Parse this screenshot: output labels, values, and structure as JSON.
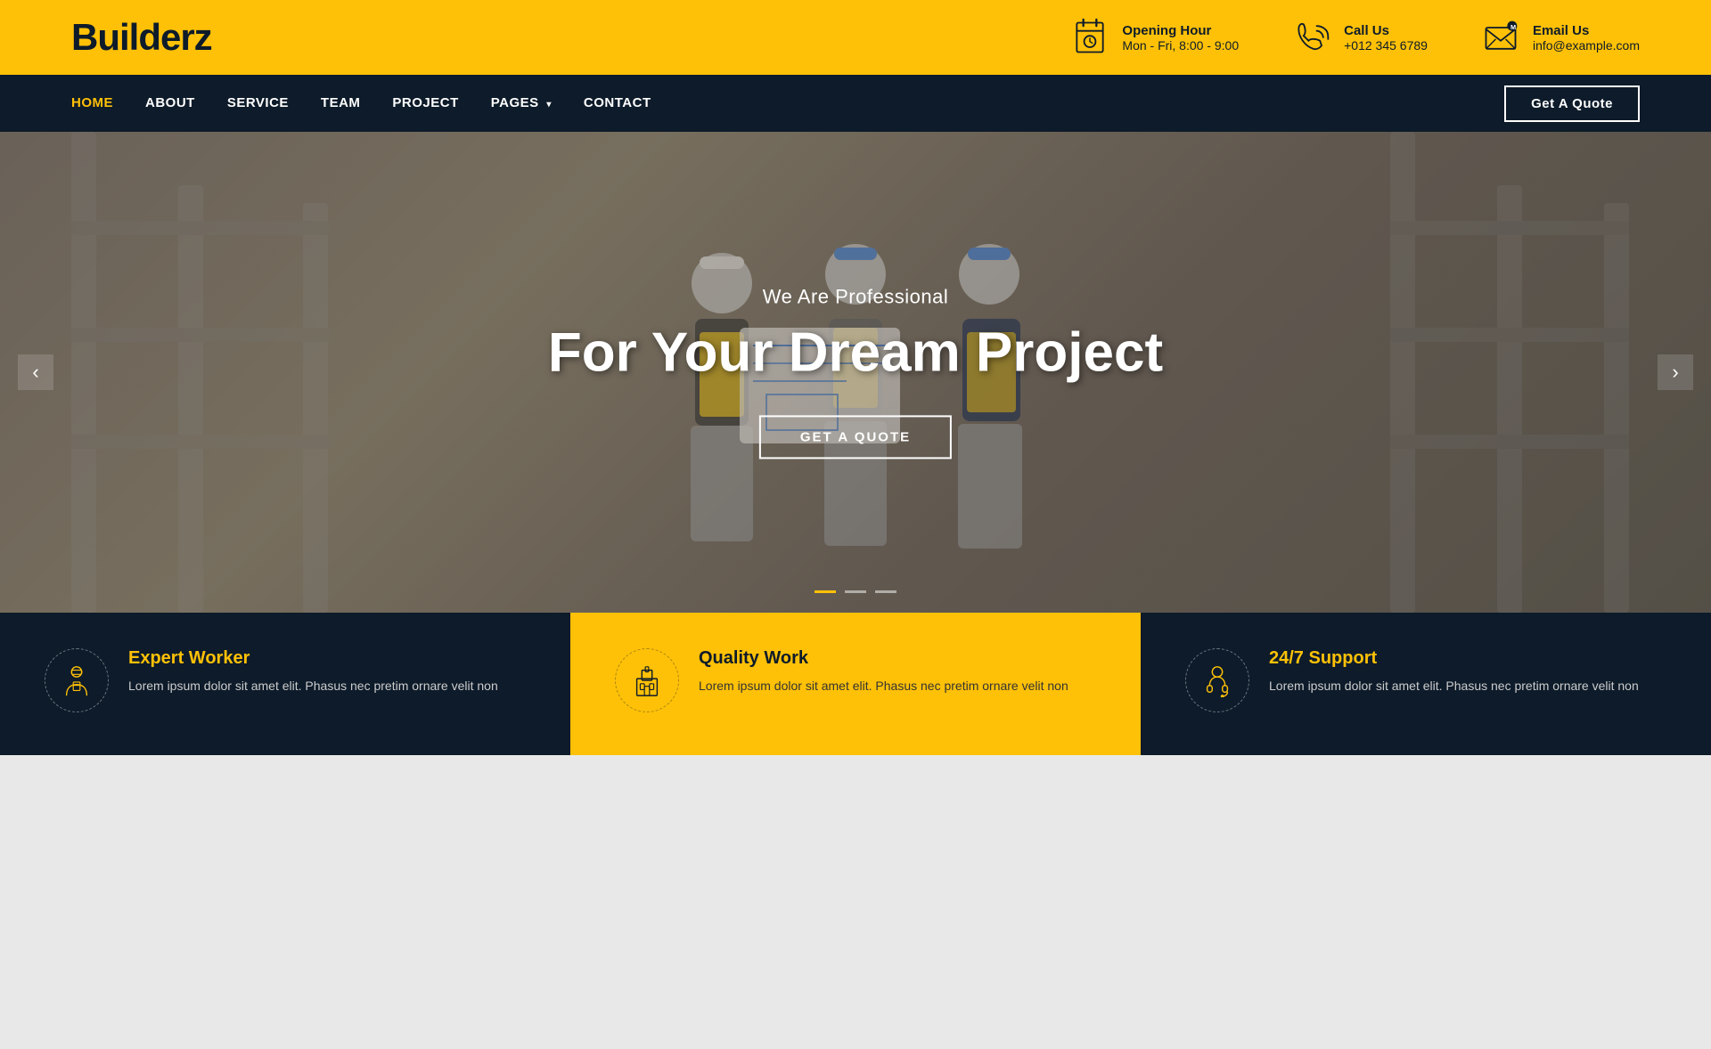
{
  "brand": {
    "logo": "Builderz"
  },
  "topbar": {
    "opening_hour": {
      "label": "Opening Hour",
      "value": "Mon - Fri, 8:00 - 9:00"
    },
    "call_us": {
      "label": "Call Us",
      "value": "+012 345 6789"
    },
    "email_us": {
      "label": "Email Us",
      "value": "info@example.com"
    }
  },
  "navbar": {
    "links": [
      {
        "id": "home",
        "label": "HOME",
        "active": true,
        "has_dropdown": false
      },
      {
        "id": "about",
        "label": "ABOUT",
        "active": false,
        "has_dropdown": false
      },
      {
        "id": "service",
        "label": "SERVICE",
        "active": false,
        "has_dropdown": false
      },
      {
        "id": "team",
        "label": "TEAM",
        "active": false,
        "has_dropdown": false
      },
      {
        "id": "project",
        "label": "PROJECT",
        "active": false,
        "has_dropdown": false
      },
      {
        "id": "pages",
        "label": "PAGES",
        "active": false,
        "has_dropdown": true
      },
      {
        "id": "contact",
        "label": "CONTACT",
        "active": false,
        "has_dropdown": false
      }
    ],
    "cta_label": "Get A Quote"
  },
  "hero": {
    "subtitle": "We Are Professional",
    "title": "For Your Dream Project",
    "cta_label": "GET A QUOTE",
    "prev_arrow": "‹",
    "next_arrow": "›",
    "dots": [
      "active",
      "",
      ""
    ]
  },
  "features": [
    {
      "id": "expert-worker",
      "title": "Expert Worker",
      "description": "Lorem ipsum dolor sit amet elit. Phasus nec pretim ornare velit non",
      "icon": "worker"
    },
    {
      "id": "quality-work",
      "title": "Quality Work",
      "description": "Lorem ipsum dolor sit amet elit. Phasus nec pretim ornare velit non",
      "icon": "building"
    },
    {
      "id": "support",
      "title": "24/7 Support",
      "description": "Lorem ipsum dolor sit amet elit. Phasus nec pretim ornare velit non",
      "icon": "headset"
    }
  ],
  "colors": {
    "primary": "#FFC107",
    "dark": "#0d1b2a",
    "white": "#ffffff"
  }
}
